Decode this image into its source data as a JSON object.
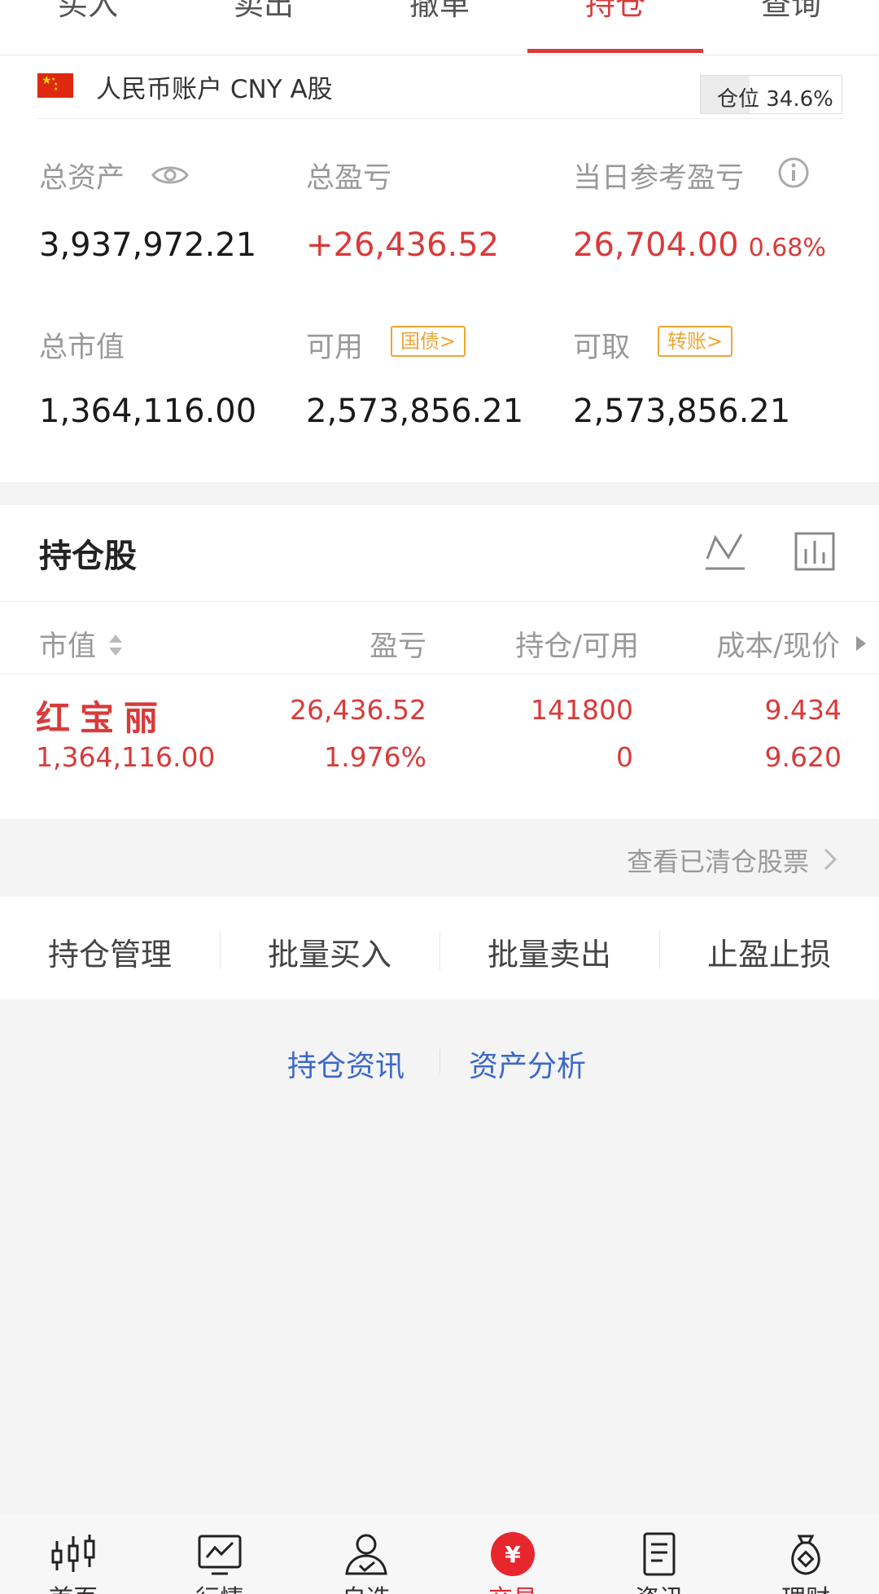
{
  "tabs": [
    {
      "label": "买入"
    },
    {
      "label": "卖出"
    },
    {
      "label": "撤单"
    },
    {
      "label": "持仓",
      "active": true
    },
    {
      "label": "查询"
    }
  ],
  "account": {
    "name": "人民币账户 CNY A股",
    "position_label": "仓位 34.6%",
    "position_ratio": 0.346
  },
  "metrics": {
    "total_assets": {
      "label": "总资产",
      "value": "3,937,972.21"
    },
    "total_pnl": {
      "label": "总盈亏",
      "value": "+26,436.52"
    },
    "daily_pnl": {
      "label": "当日参考盈亏",
      "value": "26,704.00",
      "pct": "0.68%"
    },
    "market_value": {
      "label": "总市值",
      "value": "1,364,116.00"
    },
    "available": {
      "label": "可用",
      "badge": "国债>",
      "value": "2,573,856.21"
    },
    "withdrawable": {
      "label": "可取",
      "badge": "转账>",
      "value": "2,573,856.21"
    }
  },
  "holdings": {
    "title": "持仓股",
    "columns": {
      "market_value": "市值",
      "pnl": "盈亏",
      "position": "持仓/可用",
      "cost": "成本/现价"
    },
    "rows": [
      {
        "name": "红宝丽",
        "market_value": "1,364,116.00",
        "pnl": "26,436.52",
        "pnl_pct": "1.976%",
        "position": "141800",
        "available": "0",
        "cost": "9.434",
        "price": "9.620"
      }
    ]
  },
  "cleared_link": "查看已清仓股票",
  "actions": [
    "持仓管理",
    "批量买入",
    "批量卖出",
    "止盈止损"
  ],
  "links": [
    "持仓资讯",
    "资产分析"
  ],
  "bottom_nav": [
    {
      "label": "首页",
      "icon": "candlestick-icon"
    },
    {
      "label": "行情",
      "icon": "chart-monitor-icon"
    },
    {
      "label": "自选",
      "icon": "user-check-icon"
    },
    {
      "label": "交易",
      "icon": "yuan-circle-icon",
      "active": true
    },
    {
      "label": "资讯",
      "icon": "document-icon"
    },
    {
      "label": "理财",
      "icon": "money-bag-icon"
    }
  ],
  "colors": {
    "accent": "#d93a3a",
    "badge": "#f0a531",
    "link": "#3c68c8",
    "nav_active": "#e8262d"
  }
}
